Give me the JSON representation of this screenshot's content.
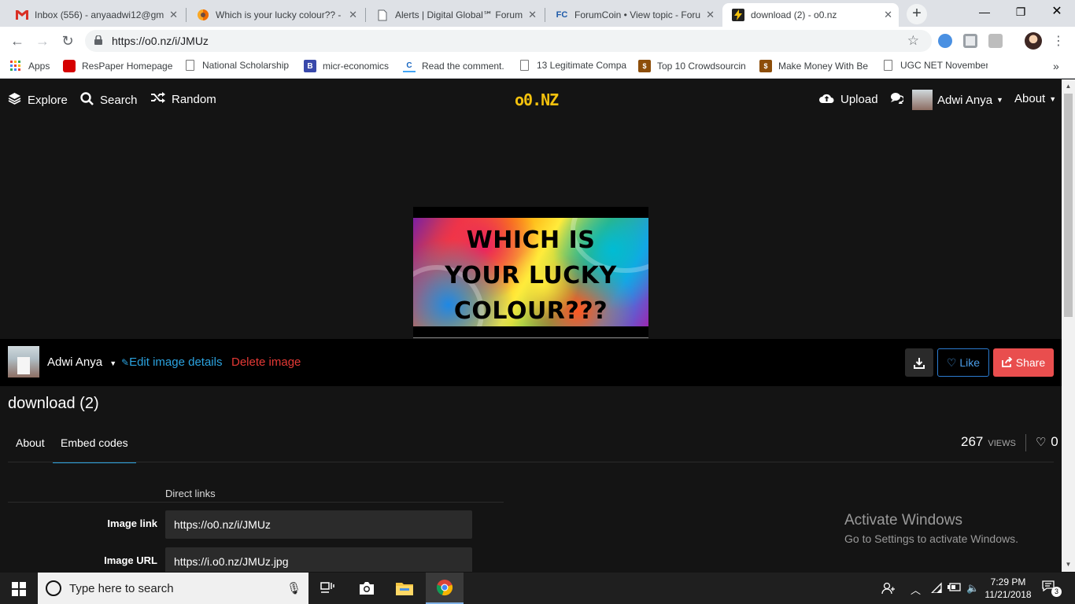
{
  "browser": {
    "tabs": [
      {
        "title": "Inbox (556) - anyaadwi12@gm",
        "favicon": "gmail-icon",
        "active": false
      },
      {
        "title": "Which is your lucky colour?? -",
        "favicon": "colour-ball-icon",
        "active": false
      },
      {
        "title": "Alerts | Digital Global℠ Forum",
        "favicon": "document-icon",
        "active": false
      },
      {
        "title": "ForumCoin • View topic - Foru",
        "favicon": "forumcoin-icon",
        "favicon_text": "FC",
        "active": false
      },
      {
        "title": "download (2) - o0.nz",
        "favicon": "lightning-icon",
        "active": true
      }
    ],
    "new_tab": "+",
    "url": "https://o0.nz/i/JMUz",
    "bookmarks": [
      {
        "label": "Apps",
        "icon": "apps-grid-icon"
      },
      {
        "label": "ResPaper Homepage",
        "icon": "respaper-icon"
      },
      {
        "label": "National Scholarship",
        "icon": "document-icon"
      },
      {
        "label": "micr-economics",
        "icon": "blogger-icon",
        "icon_text": "B"
      },
      {
        "label": "Read the comment.",
        "icon": "c-icon",
        "icon_text": "C"
      },
      {
        "label": "13 Legitimate Compa",
        "icon": "document-icon"
      },
      {
        "label": "Top 10 Crowdsourcin",
        "icon": "money-icon"
      },
      {
        "label": "Make Money With Be",
        "icon": "money-icon"
      },
      {
        "label": "UGC NET November",
        "icon": "document-icon"
      }
    ],
    "more_bookmarks": "»"
  },
  "site": {
    "logo": "o0.NZ",
    "nav": {
      "explore": "Explore",
      "search": "Search",
      "random": "Random",
      "upload": "Upload",
      "user": "Adwi Anya",
      "about": "About"
    },
    "image": {
      "overlay_lines": [
        "WHICH IS",
        "YOUR LUCKY",
        "COLOUR???"
      ],
      "title": "download (2)"
    },
    "owner": {
      "name": "Adwi Anya",
      "edit_label": "Edit image details",
      "delete_label": "Delete image"
    },
    "actions": {
      "like": "Like",
      "share": "Share"
    },
    "tabs": [
      "About",
      "Embed codes"
    ],
    "active_tab": "Embed codes",
    "stats": {
      "views": "267",
      "views_label": "VIEWS",
      "likes": "0"
    },
    "embed": {
      "section_title": "Direct links",
      "rows": [
        {
          "label": "Image link",
          "value": "https://o0.nz/i/JMUz"
        },
        {
          "label": "Image URL",
          "value": "https://i.o0.nz/JMUz.jpg"
        }
      ]
    }
  },
  "watermark": {
    "line1": "Activate Windows",
    "line2": "Go to Settings to activate Windows."
  },
  "taskbar": {
    "search_placeholder": "Type here to search",
    "time": "7:29 PM",
    "date": "11/21/2018",
    "notification_count": "3"
  },
  "colors": {
    "accent_blue": "#2ba3e0",
    "delete_red": "#e53935",
    "share_red": "#e94e4e",
    "logo_yellow": "#f4c20d",
    "page_bg": "#141414"
  }
}
